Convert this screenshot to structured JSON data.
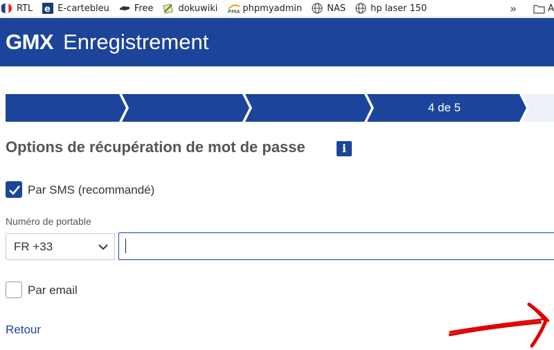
{
  "bookmarks": {
    "items": [
      {
        "label": "RTL",
        "icon": "french-flag-icon"
      },
      {
        "label": "E-cartebleu",
        "icon": "ecartebleu-icon"
      },
      {
        "label": "Free",
        "icon": "freebox-icon"
      },
      {
        "label": "dokuwiki",
        "icon": "dokuwiki-icon"
      },
      {
        "label": "phpmyadmin",
        "icon": "phpmyadmin-icon"
      },
      {
        "label": "NAS",
        "icon": "globe-icon"
      },
      {
        "label": "hp laser 150",
        "icon": "globe-icon"
      }
    ],
    "more_label": "»",
    "folder_label": "A"
  },
  "header": {
    "logo": "GMX",
    "title": "Enregistrement"
  },
  "steps": {
    "current_label": "4 de 5",
    "current": 4,
    "total": 5,
    "color": "#1c449b"
  },
  "main": {
    "title": "Options de récupération de mot de passe",
    "info_label": "i",
    "sms_option": {
      "label": "Par SMS (recommandé)",
      "checked": true
    },
    "phone_field": {
      "label": "Numéro de portable",
      "country_value": "FR +33",
      "value": ""
    },
    "email_option": {
      "label": "Par email",
      "checked": false
    },
    "back_link": "Retour"
  },
  "colors": {
    "brand": "#1c449b",
    "annotation": "#e00000"
  }
}
